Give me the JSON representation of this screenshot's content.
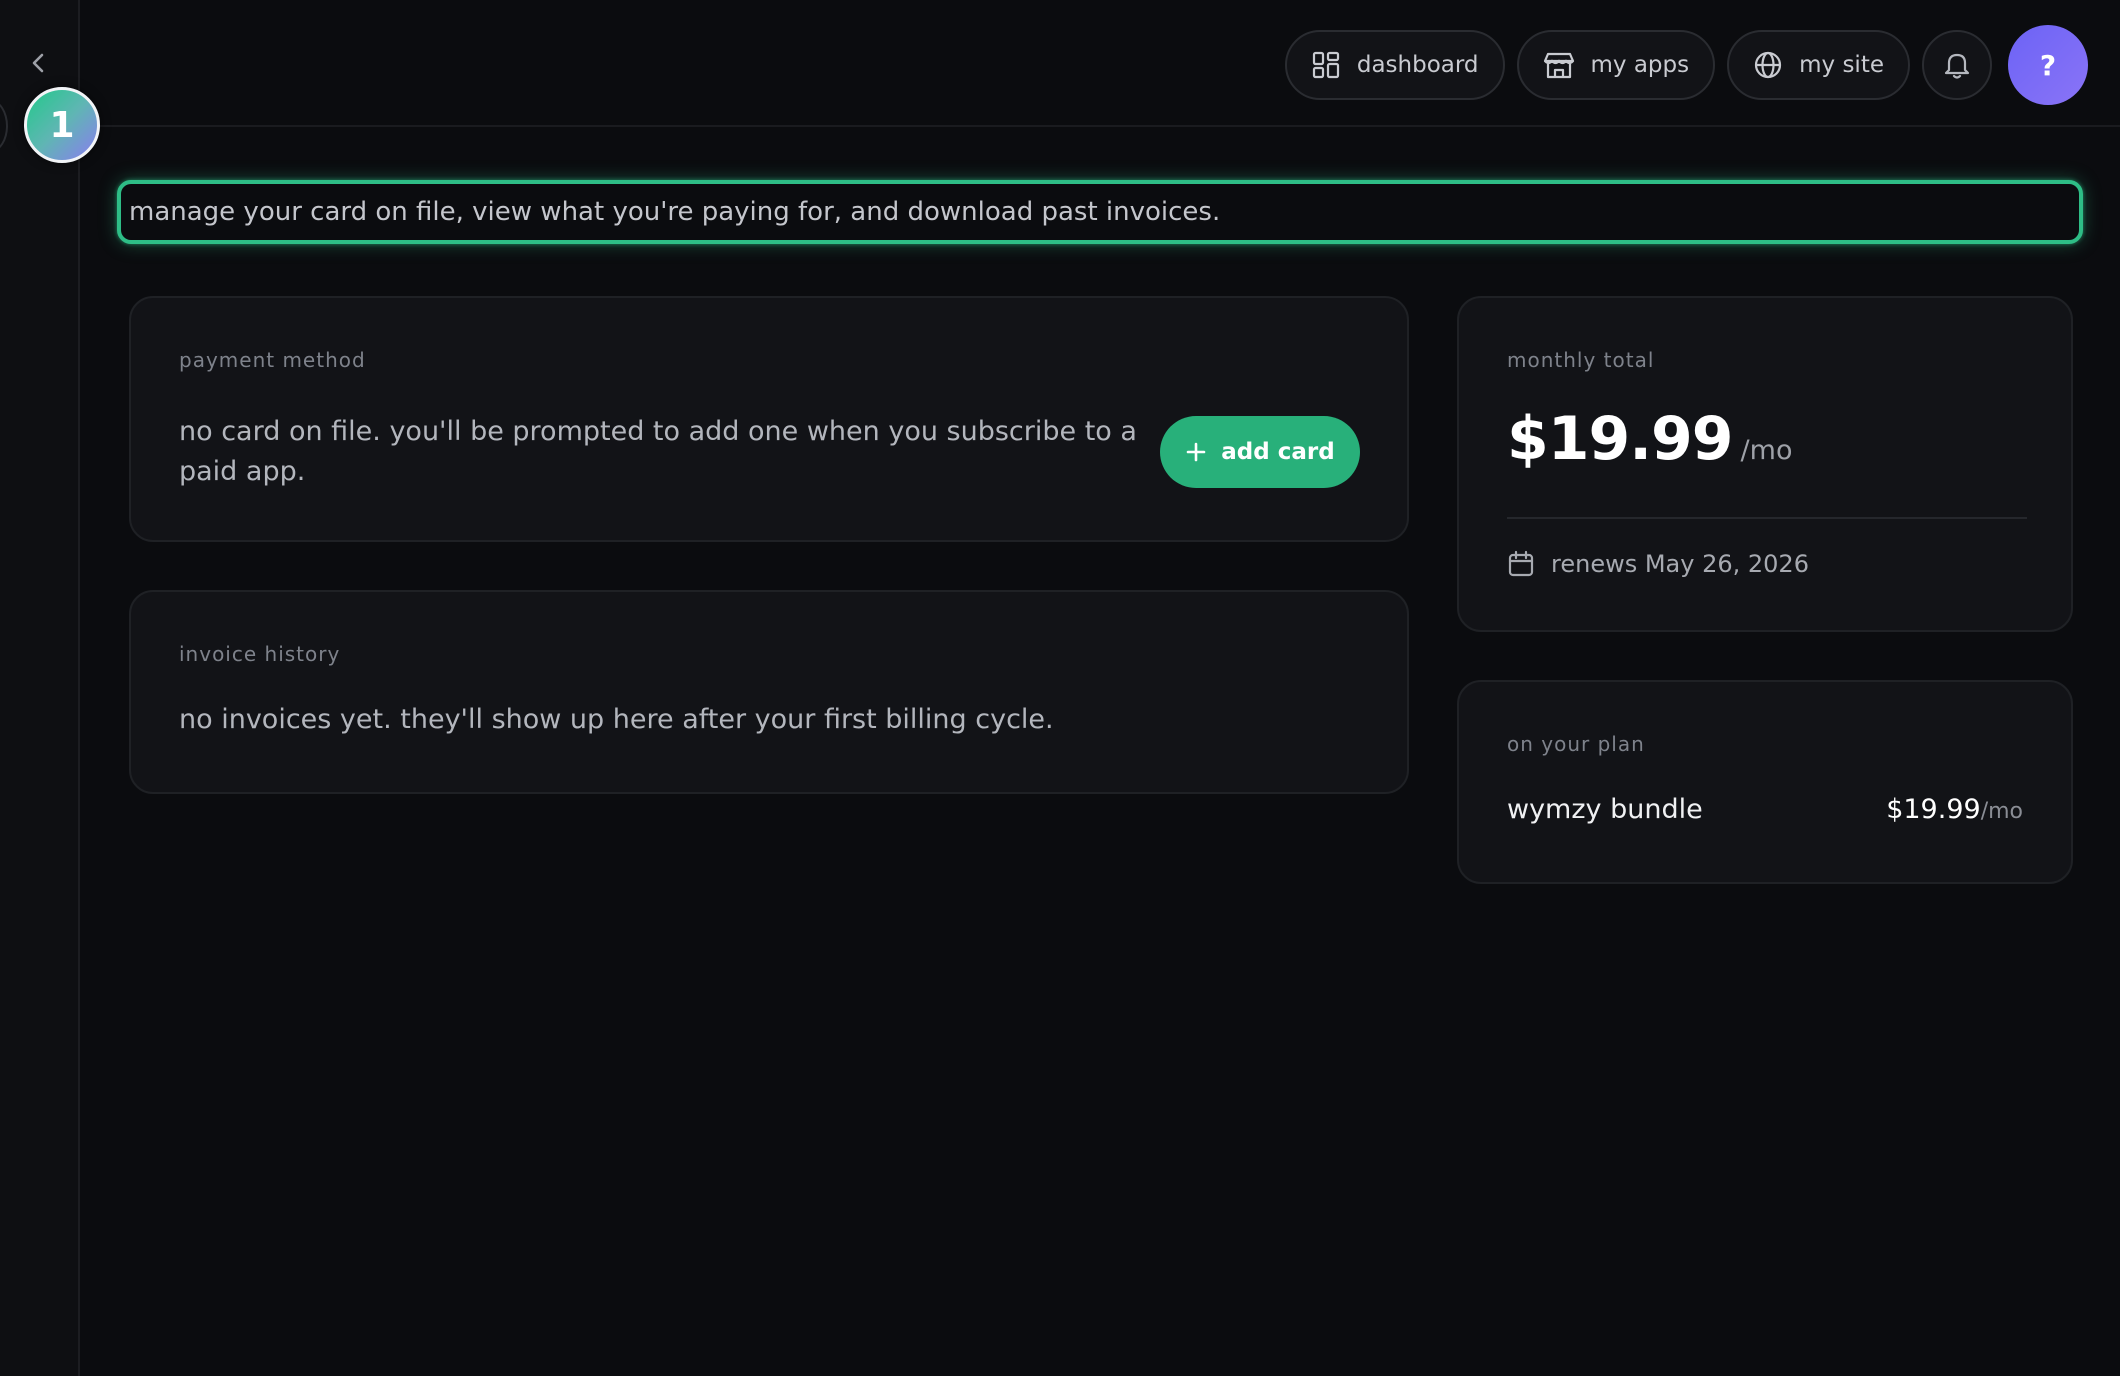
{
  "description": "manage your card on file, view what you're paying for, and download past invoices.",
  "step_badge": "1",
  "nav": {
    "dashboard": "dashboard",
    "my_apps": "my apps",
    "my_site": "my site",
    "avatar": "?"
  },
  "icons": {
    "collapse": "chevron-left-icon",
    "dashboard": "grid-icon",
    "my_apps": "store-icon",
    "my_site": "globe-icon",
    "notifications": "bell-icon",
    "add": "plus-icon",
    "calendar": "calendar-icon"
  },
  "payment": {
    "label": "payment method",
    "text": "no card on file. you'll be prompted to add one when you subscribe to a paid app.",
    "button": "add card"
  },
  "invoices": {
    "label": "invoice history",
    "text": "no invoices yet. they'll show up here after your first billing cycle."
  },
  "total": {
    "label": "monthly total",
    "amount": "$19.99",
    "per": "/mo",
    "renews": "renews May 26, 2026"
  },
  "plan": {
    "label": "on your plan",
    "name": "wymzy bundle",
    "price": "$19.99",
    "per": "/mo"
  },
  "colors": {
    "accent": "#28b07a",
    "avatar": "#6c63f5",
    "background": "#0b0c0f",
    "card": "#121317"
  }
}
